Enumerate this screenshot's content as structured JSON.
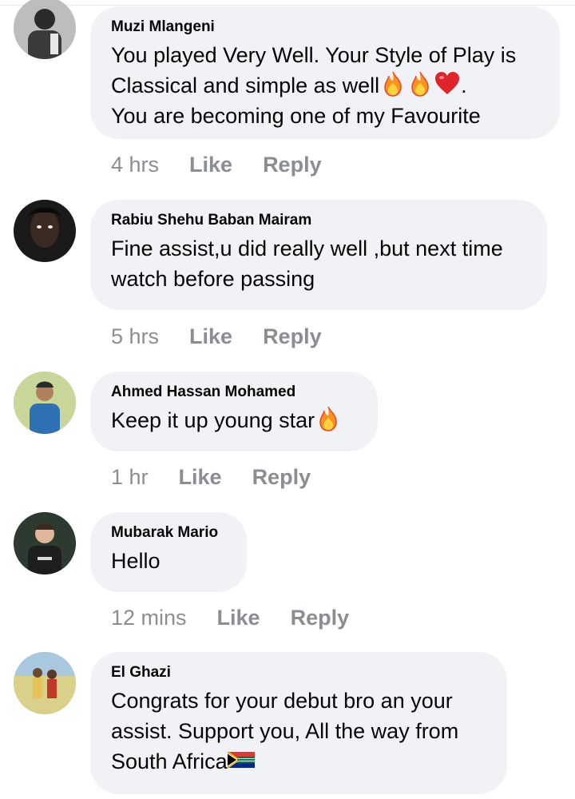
{
  "comments": [
    {
      "author": "Muzi Mlangeni",
      "lines": [
        "You played Very Well. Your Style of Play is",
        "Classical and simple as well",
        "You are becoming one of my Favourite"
      ],
      "line2_suffix": ".",
      "emojis": [
        "fire",
        "fire",
        "heart"
      ],
      "time": "4 hrs",
      "like": "Like",
      "reply": "Reply"
    },
    {
      "author": "Rabiu Shehu Baban Mairam",
      "lines": [
        "Fine assist,u did really well ,but next time",
        "watch before passing"
      ],
      "time": "5 hrs",
      "like": "Like",
      "reply": "Reply"
    },
    {
      "author": "Ahmed Hassan Mohamed",
      "lines": [
        "Keep it up young star"
      ],
      "emojis": [
        "fire"
      ],
      "time": "1 hr",
      "like": "Like",
      "reply": "Reply"
    },
    {
      "author": "Mubarak Mario",
      "lines": [
        "Hello"
      ],
      "time": "12 mins",
      "like": "Like",
      "reply": "Reply"
    },
    {
      "author": "El Ghazi",
      "lines": [
        "Congrats for your debut bro an your",
        "assist. Support you, All the way from",
        "South Africa"
      ],
      "emojis": [
        "south-africa-flag"
      ],
      "time": "",
      "like": "",
      "reply": ""
    }
  ],
  "colors": {
    "bubble": "#f0f2f5",
    "meta_text": "#8a8d91",
    "body_text": "#050505"
  }
}
